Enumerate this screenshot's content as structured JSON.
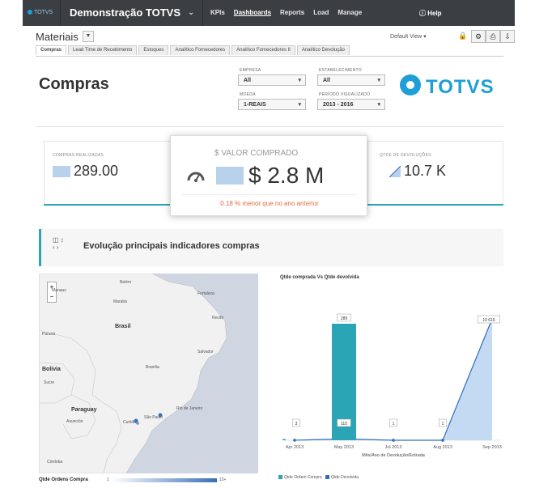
{
  "topbar": {
    "logo": "TOTVS",
    "app_title": "Demonstração TOTVS",
    "nav": [
      "KPIs",
      "Dashboards",
      "Reports",
      "Load",
      "Manage"
    ],
    "help": "Help"
  },
  "page": {
    "name": "Materiais",
    "view": "Default View",
    "tabs": [
      "Compras",
      "Lead Time de Recebimento",
      "Estoques",
      "Analítico Fornecedores",
      "Analítico Fornecedores II",
      "Analítico Devolução"
    ]
  },
  "header": {
    "title": "Compras",
    "filters": {
      "empresa_label": "EMPRESA",
      "empresa_value": "All",
      "estabelecimento_label": "ESTABELECIMENTO",
      "estabelecimento_value": "All",
      "moeda_label": "MOEDA",
      "moeda_value": "1-REAIS",
      "periodo_label": "PERÍODO VISUALIZADO",
      "periodo_value": "2013 - 2016"
    },
    "brand": "TOTVS"
  },
  "kpis": {
    "left_label": "COMPRAS REALIZADAS",
    "left_value": "289.00",
    "center_label": "$ VALOR COMPRADO",
    "center_value": "$ 2.8 M",
    "center_note": "0.18 % menor que no ano anterior",
    "right_label": "QTDE DE DEVOLUÇÕES",
    "right_value": "10.7 K"
  },
  "section": {
    "title": "Evolução principais indicadores compras"
  },
  "map": {
    "country_brasil": "Brasil",
    "country_bolivia": "Bolivia",
    "country_paraguay": "Paraguay",
    "cities": {
      "belem": "Belém",
      "manaus": "Manaus",
      "fortaleza": "Fortaleza",
      "maraba": "Marabá",
      "recife": "Recife",
      "parana": "Paraná",
      "salvador": "Salvador",
      "sucre": "Sucre",
      "brasilia": "Brasília",
      "rio": "Rio de Janeiro",
      "saopaulo": "São Paulo",
      "asuncion": "Asunción",
      "curitiba": "Curitiba",
      "cordoba": "Córdoba"
    },
    "legend_label": "Qtde Ordens Compra",
    "legend_min": "1",
    "legend_max": "12+"
  },
  "chart_data": {
    "type": "bar",
    "title": "Qtde comprada Vs Qtde devolvida",
    "categories": [
      "Apr 2013",
      "May 2013",
      "Jul 2013",
      "Aug 2013",
      "Sep 2013"
    ],
    "xlabel": "Mês/Ano de Devolução/Entrada",
    "series": [
      {
        "name": "Qtde Ordem Compra",
        "type": "bar",
        "color": "#2aa5b5",
        "values": [
          3,
          289,
          null,
          null,
          null
        ]
      },
      {
        "name": "Qtde Devolvida",
        "type": "area",
        "color": "#2f6fc0",
        "values": [
          3,
          115,
          1,
          1,
          10616
        ]
      }
    ],
    "data_labels": [
      "3",
      "289",
      "115",
      "1",
      "1",
      "10 616"
    ]
  }
}
